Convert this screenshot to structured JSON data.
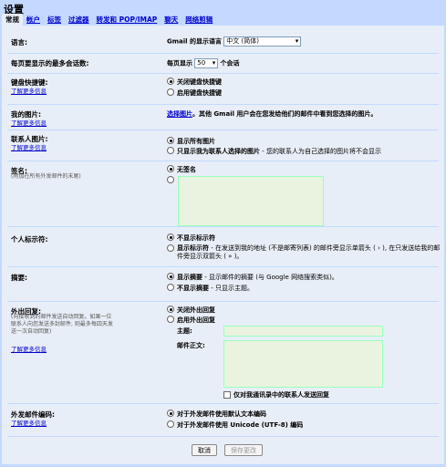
{
  "page_title": "设置",
  "tabs": [
    "常规",
    "帐户",
    "标签",
    "过滤器",
    "转发和 POP/IMAP",
    "聊天",
    "网络剪辑"
  ],
  "language": {
    "label": "语言:",
    "prefix": "Gmail 的显示语言",
    "selected": "中文 (简体)"
  },
  "page_size": {
    "label": "每页要显示的最多会话数:",
    "prefix": "每页显示",
    "selected": "50",
    "suffix": "个会话"
  },
  "shortcuts": {
    "label": "键盘快捷键:",
    "learn_more": "了解更多信息",
    "off": "关闭键盘快捷键",
    "on": "启用键盘快捷键"
  },
  "my_picture": {
    "label": "我的图片:",
    "learn_more": "了解更多信息",
    "link": "选择图片",
    "text": "。其他 Gmail 用户会在您发给他们的邮件中看到您选择的图片。"
  },
  "contact_pictures": {
    "label": "联系人图片:",
    "learn_more": "了解更多信息",
    "all": "显示所有图片",
    "mine_bold": "只显示我为联系人选择的图片",
    "mine_rest": "- 您的联系人为自己选择的图片将不会显示"
  },
  "signature": {
    "label": "签名:",
    "hint": "(附加在所有外发邮件的末尾)",
    "none": "无签名"
  },
  "personal_indicators": {
    "label": "个人标示符:",
    "off": "不显示标示符",
    "on_bold": "显示标示符",
    "on_rest": "- 在发送到我的地址 (不是邮寄列表) 的邮件旁显示单箭头 ( › ), 在只发送给我的邮件旁显示双箭头 ( » )。"
  },
  "snippets": {
    "label": "摘要:",
    "show_bold": "显示摘要",
    "show_rest": "- 显示邮件的摘要 (与 Google 网络搜索类似)。",
    "hide_bold": "不显示摘要",
    "hide_rest": "- 只显示主题。"
  },
  "vacation": {
    "label": "外出回复:",
    "hint": "(向接收到的邮件发送自动回复。如果一位联系人向您发送多封邮件, 则最多每四天发送一次自动回复)",
    "learn_more": "了解更多信息",
    "off": "关闭外出回复",
    "on": "启用外出回复",
    "subject_label": "主题:",
    "body_label": "邮件正文:",
    "contacts_only": "仅对我通讯录中的联系人发送回复"
  },
  "encoding": {
    "label": "外发邮件编码:",
    "learn_more": "了解更多信息",
    "default": "对于外发邮件使用默认文本编码",
    "utf8": "对于外发邮件使用 Unicode (UTF-8) 编码"
  },
  "buttons": {
    "cancel": "取消",
    "save": "保存更改"
  }
}
